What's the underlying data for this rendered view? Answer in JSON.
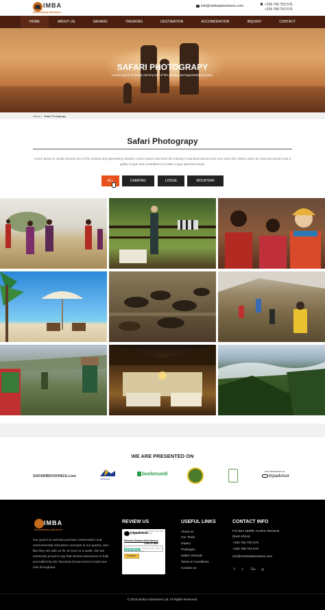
{
  "header": {
    "logo_text": "IMBA",
    "logo_tagline": "Extraordinary Adventure",
    "email": "info@simbaadventures.com",
    "phones": [
      "+255 755 753 576",
      "+255 788 753 576"
    ]
  },
  "nav": {
    "items": [
      {
        "label": "HOME"
      },
      {
        "label": "ABOUT US"
      },
      {
        "label": "SAFARIS"
      },
      {
        "label": "TREKKING"
      },
      {
        "label": "DESTINATION"
      },
      {
        "label": "ACCOMODATION"
      },
      {
        "label": "INQUIRY"
      },
      {
        "label": "CONTACT"
      }
    ]
  },
  "hero": {
    "title": "SAFARI PHOTOGRAPY",
    "subtitle": "Lorem Ipsum is simply dummy text of the printing and typesetting industry."
  },
  "breadcrumb": {
    "home": "Home",
    "separator": "|",
    "current": "Safari Photograpy"
  },
  "section": {
    "title": "Safari Photograpy",
    "description": "Lorem Ipsum is simply dummy text of the printing and typesetting industry. Lorem Ipsum has been the industry's standard dummy text ever since the 1500s, when an unknown printer took a galley of type and scrambled it to make a type specimen book."
  },
  "filters": [
    {
      "label": "ALL",
      "active": true
    },
    {
      "label": "CAMPING",
      "active": false
    },
    {
      "label": "LODGE",
      "active": false
    },
    {
      "label": "MOUNTAIN",
      "active": false
    }
  ],
  "gallery": {
    "photos": [
      "maasai-walk",
      "lodge-zebra",
      "maasai-women",
      "beach-umbrella",
      "wildebeest-migration",
      "trek-hillside",
      "kilimanjaro-porters",
      "tent-interior",
      "forest-valley"
    ]
  },
  "partners": {
    "heading": "WE ARE PRESENTED ON",
    "names": [
      "SAFARIBOOKINGS.com",
      "TANZANIA",
      "bookmundi",
      "",
      "",
      "tripadvisor"
    ],
    "tripadvisor_note": "RECOMMENDED ON"
  },
  "footer": {
    "about": "Our goal is to actively promote conservation and environmental education concepts to our guests, who like they are with us for an hour or a week. We are extremely proud to say that Simba Adventures is fully accredited by the Tanzania Government to lead tour-rists throughout.",
    "review_heading": "REVIEW US",
    "review_widget": {
      "brand": "tripadvisor",
      "tagline": "Know better. Book better. Go better.",
      "title": "Review Simba Adventures",
      "subtitle": "Click to rate:",
      "input_placeholder": "Title your review - Describe your stay in one sentence or less.",
      "button": "Continue"
    },
    "links_heading": "USEFUL LINKS",
    "links": [
      "About us",
      "Our Team",
      "Inquiry",
      "Packages",
      "Safari Vehicals",
      "Terms & Conditions",
      "Contact us"
    ],
    "contact_heading": "CONTACT INFO",
    "contact": [
      "P.O.Box 15099, Arusha Tanzania",
      "(East Africa)",
      "+255 755 753 576",
      "+255 788 753 576",
      "info@simbaadventures.com"
    ],
    "social": [
      "f",
      "t",
      "G+",
      "◎"
    ],
    "copyright": "© 2019 Simba Adventures Ltd. All Rights Reserved."
  },
  "colors": {
    "nav": "#4a1f10",
    "accent": "#e8501c",
    "footer": "#000000"
  }
}
